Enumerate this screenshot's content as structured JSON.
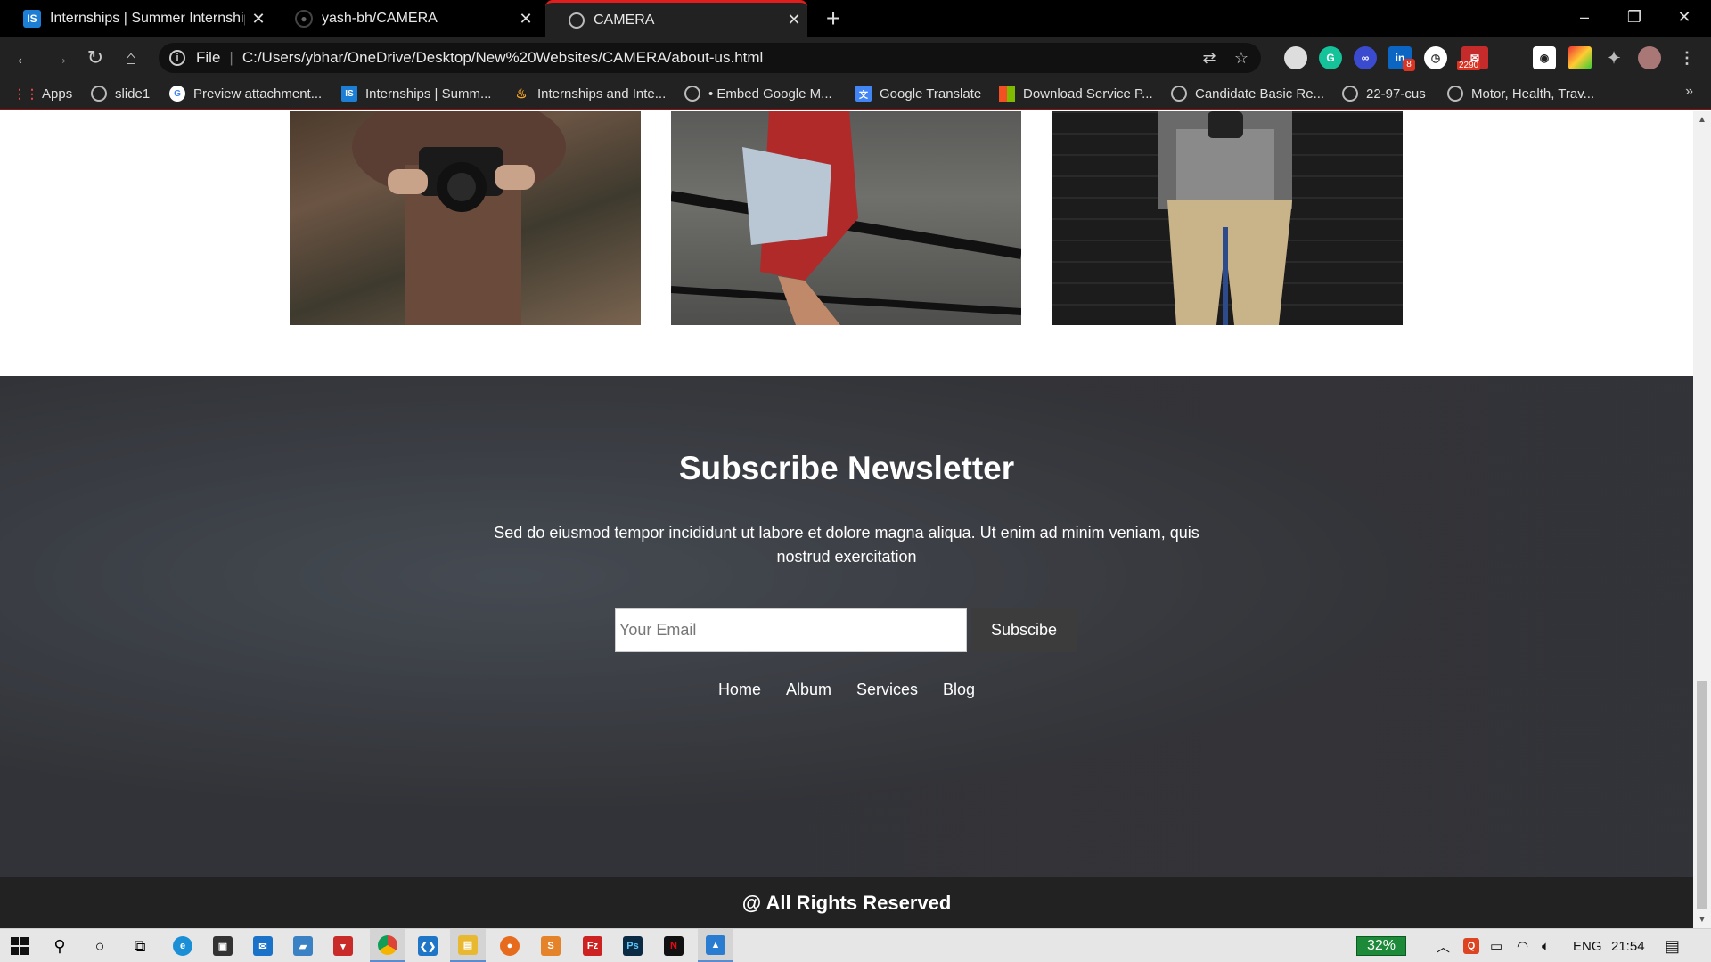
{
  "browser": {
    "tabs": [
      {
        "title": "Internships | Summer Internship",
        "icon": "internshala-icon",
        "active": false
      },
      {
        "title": "yash-bh/CAMERA",
        "icon": "github-icon",
        "active": false
      },
      {
        "title": "CAMERA",
        "icon": "globe-icon",
        "active": true
      }
    ],
    "window_controls": {
      "minimize": "–",
      "maximize": "❐",
      "close": "✕"
    },
    "address": {
      "scheme_label": "File",
      "url": "C:/Users/ybhar/OneDrive/Desktop/New%20Websites/CAMERA/about-us.html"
    },
    "extensions": {
      "linkedin_badge": "8",
      "mail_badge": "2290"
    },
    "bookmarks": [
      {
        "label": "Apps",
        "icon": "apps-grid-icon"
      },
      {
        "label": "slide1",
        "icon": "globe-icon"
      },
      {
        "label": "Preview attachment...",
        "icon": "google-icon"
      },
      {
        "label": "Internships | Summ...",
        "icon": "internshala-icon"
      },
      {
        "label": "Internships and Inte...",
        "icon": "flame-icon"
      },
      {
        "label": "• Embed Google M...",
        "icon": "globe-icon"
      },
      {
        "label": "Google Translate",
        "icon": "translate-icon"
      },
      {
        "label": "Download Service P...",
        "icon": "microsoft-icon"
      },
      {
        "label": "Candidate Basic Re...",
        "icon": "globe-icon"
      },
      {
        "label": "22-97-cus",
        "icon": "globe-icon"
      },
      {
        "label": "Motor, Health, Trav...",
        "icon": "globe-icon"
      }
    ]
  },
  "page": {
    "gallery_alts": [
      "woman holding camera",
      "person on railing with camera",
      "man standing at brick wall"
    ],
    "newsletter": {
      "title": "Subscribe Newsletter",
      "text": "Sed do eiusmod tempor incididunt ut labore et dolore magna aliqua. Ut enim ad minim veniam, quis nostrud exercitation",
      "email_placeholder": "Your Email",
      "button_label": "Subscibe",
      "links": [
        "Home",
        "Album",
        "Services",
        "Blog"
      ]
    },
    "footer": {
      "text": "@ All Rights Reserved"
    }
  },
  "taskbar": {
    "battery": "32%",
    "language": "ENG",
    "time": "21:54"
  },
  "colors": {
    "accent_red": "#e21d1d",
    "footer_bg": "#222222",
    "button_bg": "#3c3c3c"
  }
}
